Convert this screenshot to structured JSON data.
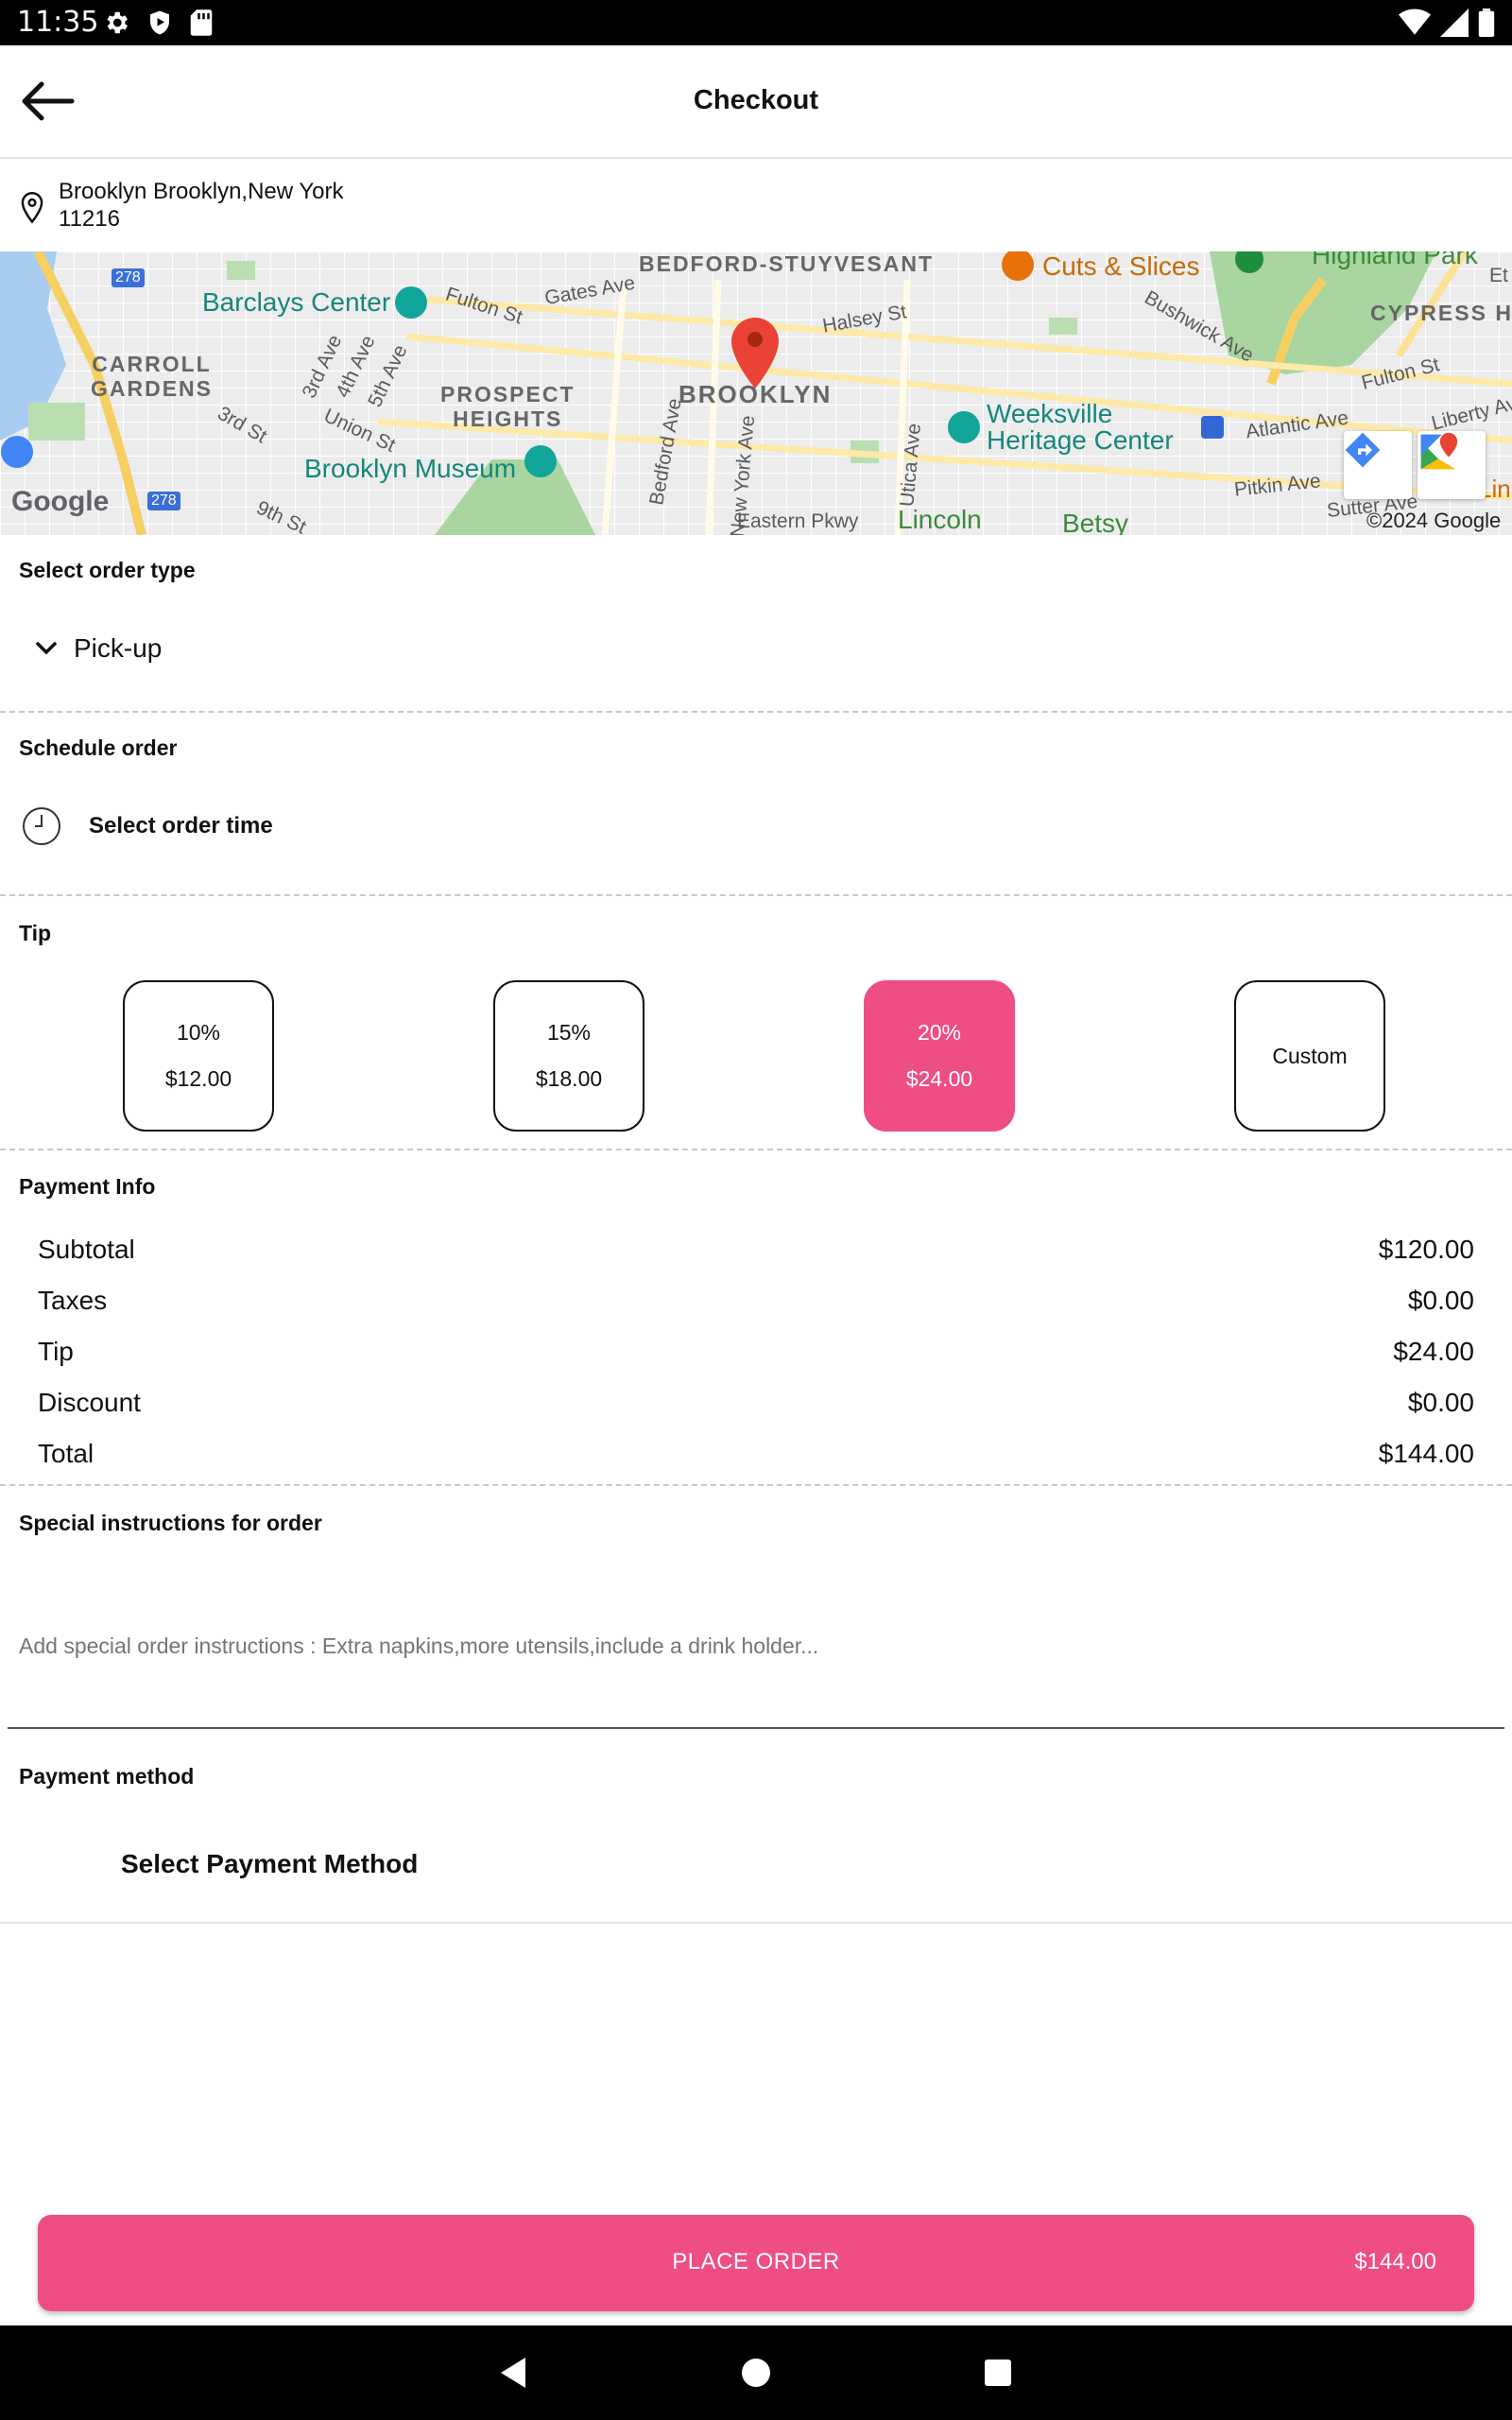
{
  "status_bar": {
    "time": "11:35",
    "left_icons": [
      "gear-icon",
      "shield-play-icon",
      "sd-card-icon"
    ],
    "right_icons": [
      "wifi-icon",
      "signal-icon",
      "battery-icon"
    ]
  },
  "app_bar": {
    "title": "Checkout",
    "back_icon": "arrow-left-icon"
  },
  "address": {
    "line1": "Brooklyn  Brooklyn,New York",
    "line2": "11216",
    "icon": "location-pin-icon"
  },
  "map": {
    "labels": {
      "bedford": "BEDFORD-STUYVESANT",
      "cuts": "Cuts & Slices",
      "highland": "Highland Park",
      "barclays": "Barclays Center",
      "gates": "Gates Ave",
      "halsey": "Halsey St",
      "fulton1": "Fulton St",
      "bushwick": "Bushwick Ave",
      "cypress": "CYPRESS H",
      "carroll": "CARROLL\nGARDENS",
      "third_ave": "3rd Ave",
      "fourth_ave": "4th Ave",
      "fifth_ave": "5th Ave",
      "prospect": "PROSPECT\nHEIGHTS",
      "brooklyn": "BROOKLYN",
      "weeksville": "Weeksville\nHeritage Center",
      "atlantic": "Atlantic Ave",
      "fulton2": "Fulton St",
      "liberty": "Liberty Av",
      "third_st": "3rd St",
      "union": "Union St",
      "museum": "Brooklyn Museum",
      "bedford_ave": "Bedford Ave",
      "newyork_ave": "New York Ave",
      "utica": "Utica Ave",
      "pitkin": "Pitkin Ave",
      "sutter": "Sutter Ave",
      "ninth": "9th St",
      "eastern": "Eastern Pkwy",
      "lincoln": "Lincoln",
      "betsy": "Betsy",
      "linc2": "Linc",
      "etna": "Et",
      "shield1": "278",
      "shield2": "278",
      "google": "Google",
      "copyright": "©2024 Google"
    }
  },
  "order_type": {
    "title": "Select order type",
    "selected": "Pick-up"
  },
  "schedule": {
    "title": "Schedule order",
    "label": "Select order time"
  },
  "tip": {
    "title": "Tip",
    "options": [
      {
        "percent": "10%",
        "amount": "$12.00"
      },
      {
        "percent": "15%",
        "amount": "$18.00"
      },
      {
        "percent": "20%",
        "amount": "$24.00"
      },
      {
        "label": "Custom"
      }
    ],
    "selected_index": 2
  },
  "payment_info": {
    "title": "Payment Info",
    "rows": [
      {
        "label": "Subtotal",
        "value": "$120.00"
      },
      {
        "label": "Taxes",
        "value": "$0.00"
      },
      {
        "label": "Tip",
        "value": "$24.00"
      },
      {
        "label": "Discount",
        "value": "$0.00"
      },
      {
        "label": "Total",
        "value": "$144.00"
      }
    ]
  },
  "special_instructions": {
    "title": "Special instructions for order",
    "placeholder": "Add special order instructions : Extra napkins,more utensils,include a drink holder...",
    "value": ""
  },
  "payment_method": {
    "title": "Payment method",
    "label": "Select Payment Method"
  },
  "place_order": {
    "label": "PLACE ORDER",
    "amount": "$144.00"
  },
  "colors": {
    "accent": "#ef4d85",
    "statusbar": "#000000"
  }
}
